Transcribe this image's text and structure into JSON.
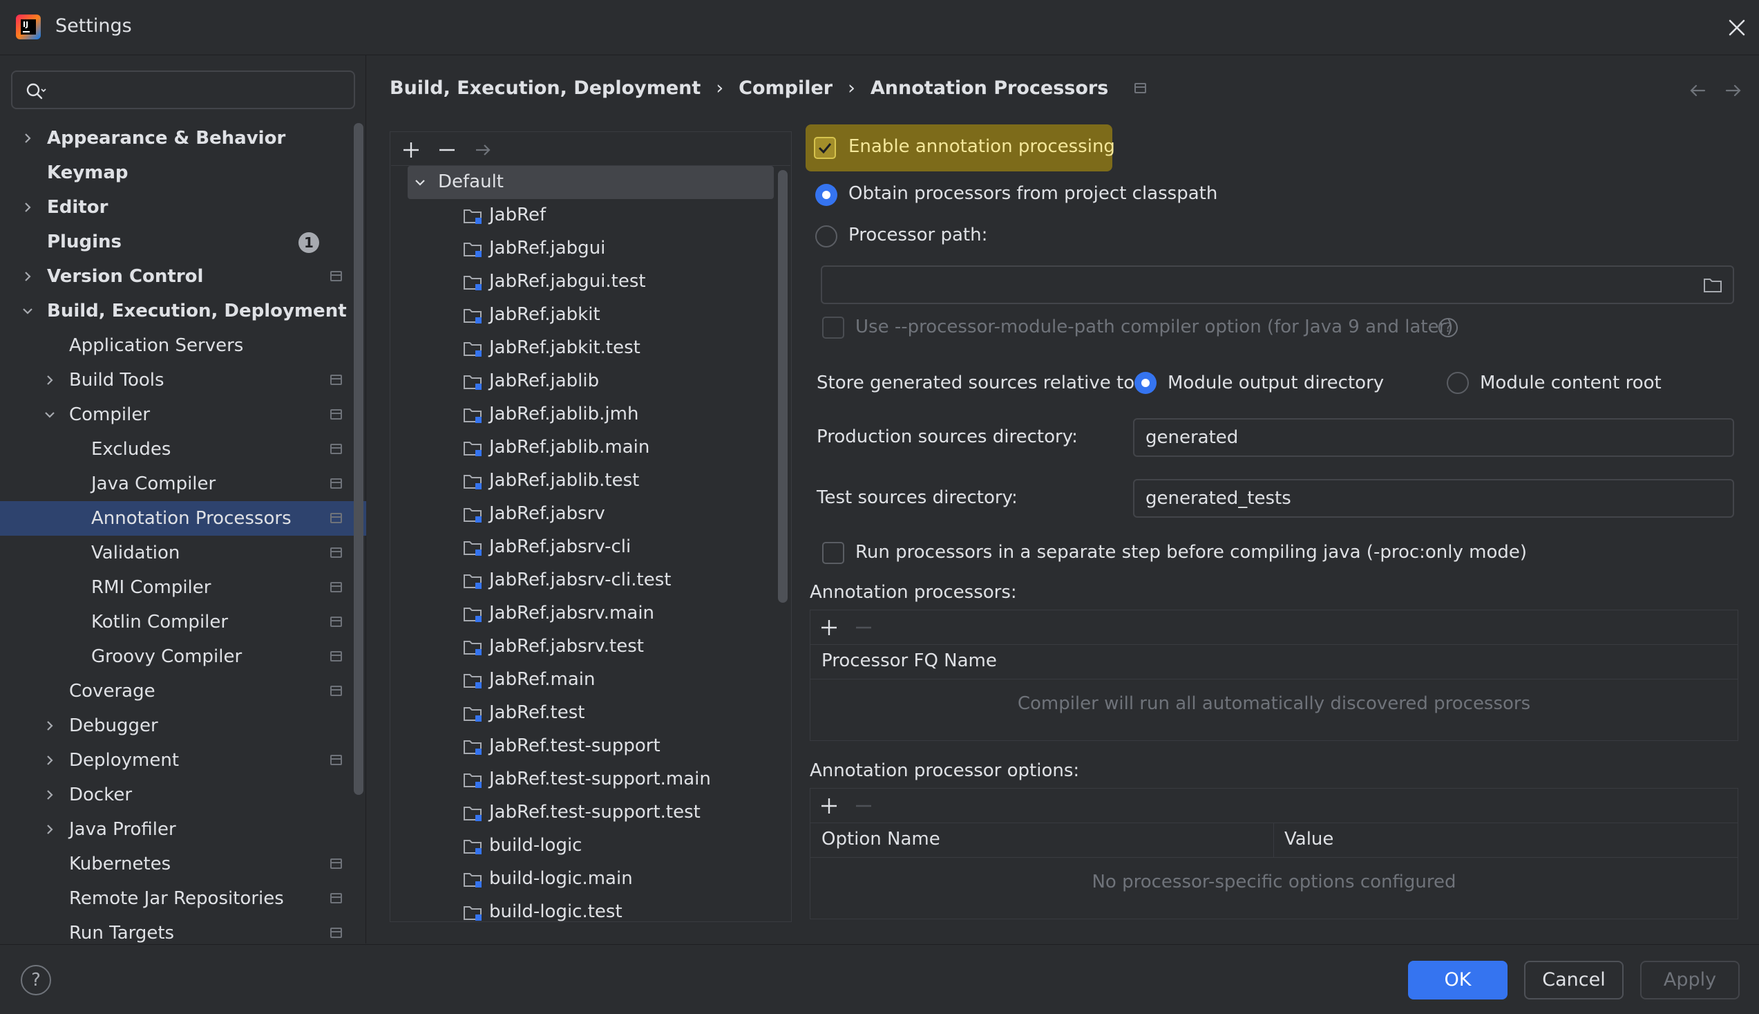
{
  "window": {
    "title": "Settings"
  },
  "search": {
    "placeholder": ""
  },
  "sidebar": {
    "items": [
      {
        "label": "Appearance & Behavior",
        "level": 0,
        "chevron": "right",
        "pin": false
      },
      {
        "label": "Keymap",
        "level": 0,
        "chevron": "none",
        "pin": false
      },
      {
        "label": "Editor",
        "level": 0,
        "chevron": "right",
        "pin": false
      },
      {
        "label": "Plugins",
        "level": 0,
        "chevron": "none",
        "pin": false,
        "badge": "1"
      },
      {
        "label": "Version Control",
        "level": 0,
        "chevron": "right",
        "pin": true
      },
      {
        "label": "Build, Execution, Deployment",
        "level": 0,
        "chevron": "down",
        "pin": false
      },
      {
        "label": "Application Servers",
        "level": 1,
        "chevron": "none",
        "pin": false
      },
      {
        "label": "Build Tools",
        "level": 1,
        "chevron": "right",
        "pin": true
      },
      {
        "label": "Compiler",
        "level": 1,
        "chevron": "down",
        "pin": true
      },
      {
        "label": "Excludes",
        "level": 2,
        "chevron": "none",
        "pin": true
      },
      {
        "label": "Java Compiler",
        "level": 2,
        "chevron": "none",
        "pin": true
      },
      {
        "label": "Annotation Processors",
        "level": 2,
        "chevron": "none",
        "pin": true,
        "selected": true
      },
      {
        "label": "Validation",
        "level": 2,
        "chevron": "none",
        "pin": true
      },
      {
        "label": "RMI Compiler",
        "level": 2,
        "chevron": "none",
        "pin": true
      },
      {
        "label": "Kotlin Compiler",
        "level": 2,
        "chevron": "none",
        "pin": true
      },
      {
        "label": "Groovy Compiler",
        "level": 2,
        "chevron": "none",
        "pin": true
      },
      {
        "label": "Coverage",
        "level": 1,
        "chevron": "none",
        "pin": true
      },
      {
        "label": "Debugger",
        "level": 1,
        "chevron": "right",
        "pin": false
      },
      {
        "label": "Deployment",
        "level": 1,
        "chevron": "right",
        "pin": true
      },
      {
        "label": "Docker",
        "level": 1,
        "chevron": "right",
        "pin": false
      },
      {
        "label": "Java Profiler",
        "level": 1,
        "chevron": "right",
        "pin": false
      },
      {
        "label": "Kubernetes",
        "level": 1,
        "chevron": "none",
        "pin": true
      },
      {
        "label": "Remote Jar Repositories",
        "level": 1,
        "chevron": "none",
        "pin": true
      },
      {
        "label": "Run Targets",
        "level": 1,
        "chevron": "none",
        "pin": true
      }
    ]
  },
  "breadcrumb": [
    "Build, Execution, Deployment",
    "Compiler",
    "Annotation Processors"
  ],
  "modules": {
    "root": "Default",
    "items": [
      "JabRef",
      "JabRef.jabgui",
      "JabRef.jabgui.test",
      "JabRef.jabkit",
      "JabRef.jabkit.test",
      "JabRef.jablib",
      "JabRef.jablib.jmh",
      "JabRef.jablib.main",
      "JabRef.jablib.test",
      "JabRef.jabsrv",
      "JabRef.jabsrv-cli",
      "JabRef.jabsrv-cli.test",
      "JabRef.jabsrv.main",
      "JabRef.jabsrv.test",
      "JabRef.main",
      "JabRef.test",
      "JabRef.test-support",
      "JabRef.test-support.main",
      "JabRef.test-support.test",
      "build-logic",
      "build-logic.main",
      "build-logic.test"
    ]
  },
  "form": {
    "enable_label": "Enable annotation processing",
    "obtain_label": "Obtain processors from project classpath",
    "processor_path_label": "Processor path:",
    "processor_path_value": "",
    "module_path_label": "Use --processor-module-path compiler option (for Java 9 and later)",
    "store_label": "Store generated sources relative to:",
    "module_output_label": "Module output directory",
    "module_content_label": "Module content root",
    "production_label": "Production sources directory:",
    "production_value": "generated",
    "test_label": "Test sources directory:",
    "test_value": "generated_tests",
    "proc_only_label": "Run processors in a separate step before compiling java (-proc:only mode)",
    "processors_title": "Annotation processors:",
    "processors_col": "Processor FQ Name",
    "processors_empty": "Compiler will run all automatically discovered processors",
    "options_title": "Annotation processor options:",
    "options_col_name": "Option Name",
    "options_col_value": "Value",
    "options_empty": "No processor-specific options configured"
  },
  "footer": {
    "help": "?",
    "ok": "OK",
    "cancel": "Cancel",
    "apply": "Apply"
  },
  "colors": {
    "accent": "#3574f0",
    "selected": "#2e436e",
    "highlight": "#7d6b1a",
    "background": "#2b2d30"
  }
}
